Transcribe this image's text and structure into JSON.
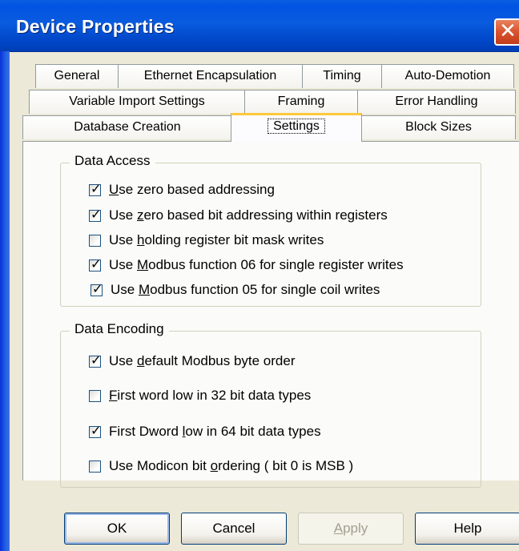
{
  "window": {
    "title": "Device Properties"
  },
  "tabs": {
    "row1": [
      "General",
      "Ethernet Encapsulation",
      "Timing",
      "Auto-Demotion"
    ],
    "row2": [
      "Variable Import Settings",
      "Framing",
      "Error Handling"
    ],
    "row3": [
      "Database Creation",
      "Settings",
      "Block Sizes"
    ],
    "active": "Settings"
  },
  "data_access": {
    "legend": "Data Access",
    "items": [
      {
        "pre": "",
        "key": "U",
        "post": "se zero based addressing",
        "checked": true
      },
      {
        "pre": "Use ",
        "key": "z",
        "post": "ero based bit addressing within registers",
        "checked": true
      },
      {
        "pre": "Use ",
        "key": "h",
        "post": "olding register bit mask writes",
        "checked": false
      },
      {
        "pre": "Use ",
        "key": "M",
        "post": "odbus function 06 for single register writes",
        "checked": true
      },
      {
        "pre": "Use ",
        "key": "M",
        "post": "odbus function 05 for single coil writes",
        "checked": true
      }
    ]
  },
  "data_encoding": {
    "legend": "Data Encoding",
    "items": [
      {
        "pre": "Use ",
        "key": "d",
        "post": "efault Modbus byte order",
        "checked": true
      },
      {
        "pre": "",
        "key": "F",
        "post": "irst word low in 32 bit data types",
        "checked": false
      },
      {
        "pre": "First Dword ",
        "key": "l",
        "post": "ow in 64 bit data types",
        "checked": true
      },
      {
        "pre": "Use Modicon bit ",
        "key": "o",
        "post": "rdering ( bit 0 is MSB )",
        "checked": false
      }
    ]
  },
  "buttons": {
    "ok": "OK",
    "cancel": "Cancel",
    "apply": "Apply",
    "help": "Help"
  }
}
